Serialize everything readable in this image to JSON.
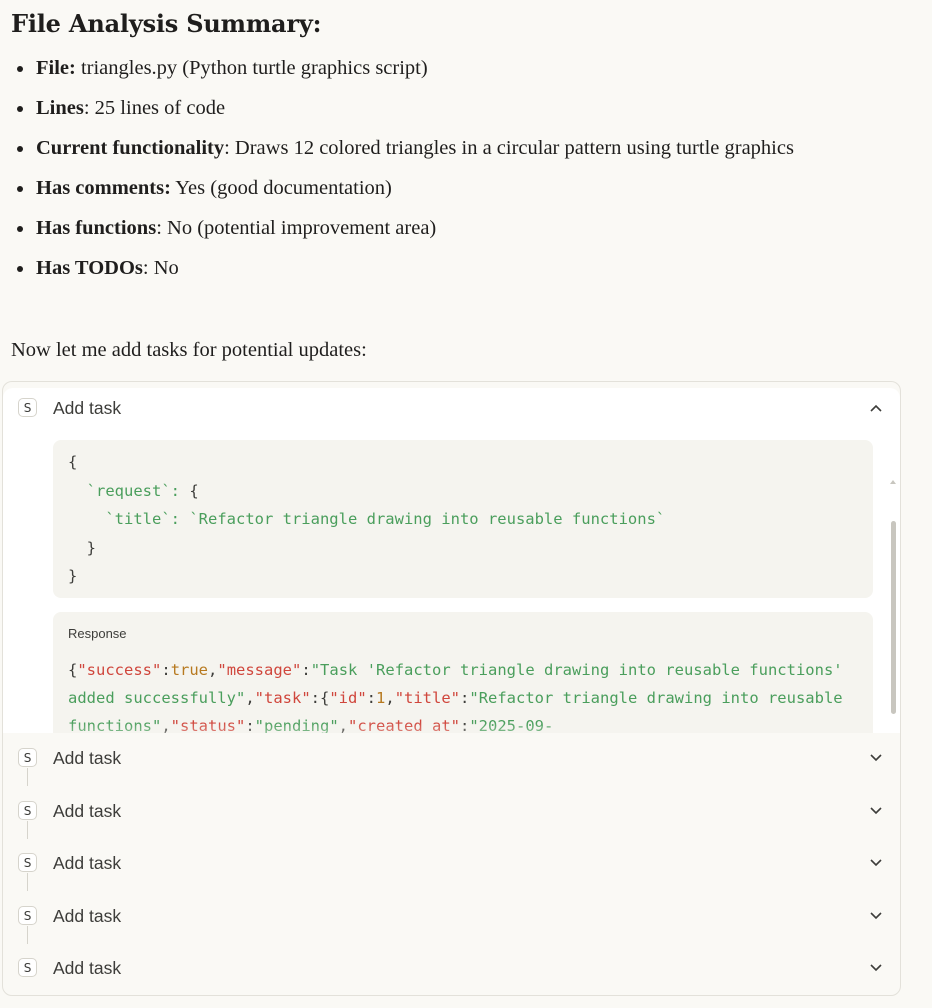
{
  "heading": "File Analysis Summary:",
  "bullets": [
    {
      "label": "File:",
      "text": " triangles.py (Python turtle graphics script)"
    },
    {
      "label": "Lines",
      "text": ": 25 lines of code"
    },
    {
      "label": "Current functionality",
      "text": ": Draws 12 colored triangles in a circular pattern using turtle graphics"
    },
    {
      "label": "Has comments:",
      "text": " Yes (good documentation)"
    },
    {
      "label": "Has functions",
      "text": ": No (potential improvement area)"
    },
    {
      "label": "Has TODOs",
      "text": ": No"
    }
  ],
  "intro": "Now let me add tasks for potential updates:",
  "tool_calls": [
    {
      "badge": "S",
      "label": "Add task",
      "expanded": true
    },
    {
      "badge": "S",
      "label": "Add task",
      "expanded": false
    },
    {
      "badge": "S",
      "label": "Add task",
      "expanded": false
    },
    {
      "badge": "S",
      "label": "Add task",
      "expanded": false
    },
    {
      "badge": "S",
      "label": "Add task",
      "expanded": false
    },
    {
      "badge": "S",
      "label": "Add task",
      "expanded": false
    }
  ],
  "request": {
    "line1": "{",
    "line2_key": "`request`",
    "line2_rest": ": {",
    "line3_key": "`title`",
    "line3_sep": ": ",
    "line3_value": "`Refactor triangle drawing into reusable functions`",
    "line4": "}",
    "line5": "}"
  },
  "response": {
    "title": "Response",
    "text": "{\"success\":true,\"message\":\"Task 'Refactor triangle drawing into reusable functions' added successfully\",\"task\":{\"id\":1,\"title\":\"Refactor triangle drawing into reusable functions\",\"status\":\"pending\",\"created_at\":\"2025-09-"
  },
  "colors": {
    "background": "#faf9f5",
    "code_bg": "#f5f4ef",
    "json_key": "#d0463c",
    "json_string": "#4a9e5c",
    "json_bool": "#b7791f"
  }
}
